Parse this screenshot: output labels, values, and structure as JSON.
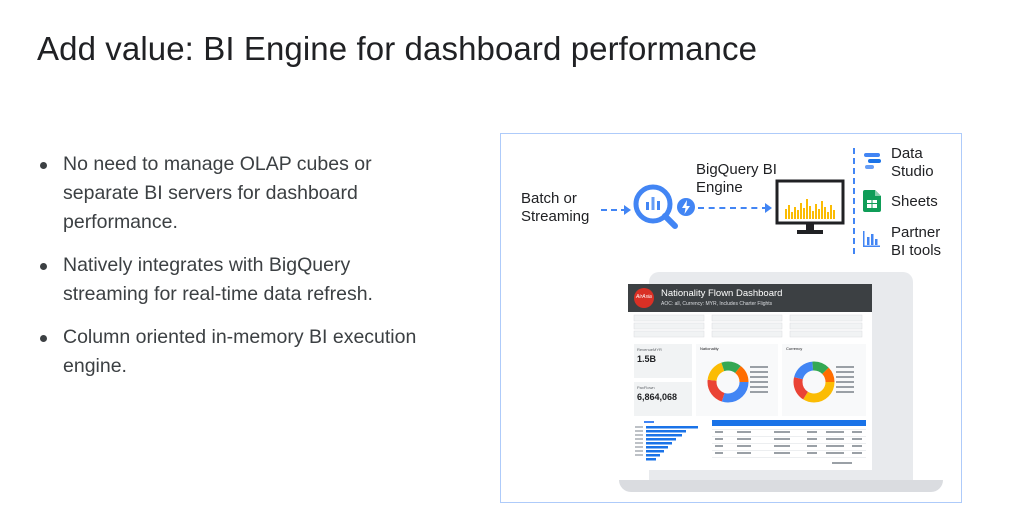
{
  "slide": {
    "title": "Add value: BI Engine for dashboard performance",
    "bullets": [
      "No need to manage OLAP cubes or separate BI servers for dashboard performance.",
      "Natively integrates with BigQuery streaming for real-time data refresh.",
      "Column oriented in-memory BI execution engine."
    ]
  },
  "diagram": {
    "source_label": "Batch or Streaming",
    "engine_label": "BigQuery BI Engine",
    "targets": [
      {
        "label": "Data Studio",
        "icon": "data-studio-icon",
        "color": "#4285f4"
      },
      {
        "label": "Sheets",
        "icon": "sheets-icon",
        "color": "#0f9d58"
      },
      {
        "label": "Partner BI tools",
        "icon": "partner-bi-icon",
        "color": "#4285f4"
      }
    ],
    "accent": "#4285f4"
  },
  "dashboard": {
    "title": "Nationality Flown Dashboard",
    "subtitle": "AOC: all, Currency: MYR, Includes Charter Flights",
    "logo_text": "AirAsia",
    "kpis": [
      {
        "label": "RevenueMYR",
        "value": "1.5B"
      },
      {
        "label": "PaxFlown",
        "value": "6,864,068"
      }
    ],
    "donut_titles": [
      "Nationality",
      "Currency"
    ]
  }
}
